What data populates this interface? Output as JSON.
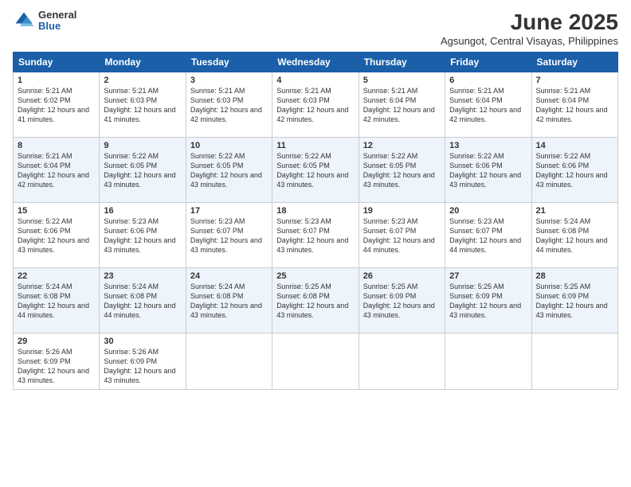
{
  "logo": {
    "general": "General",
    "blue": "Blue"
  },
  "header": {
    "month": "June 2025",
    "location": "Agsungot, Central Visayas, Philippines"
  },
  "weekdays": [
    "Sunday",
    "Monday",
    "Tuesday",
    "Wednesday",
    "Thursday",
    "Friday",
    "Saturday"
  ],
  "weeks": [
    [
      {
        "day": "1",
        "sunrise": "5:21 AM",
        "sunset": "6:02 PM",
        "daylight": "12 hours and 41 minutes."
      },
      {
        "day": "2",
        "sunrise": "5:21 AM",
        "sunset": "6:03 PM",
        "daylight": "12 hours and 41 minutes."
      },
      {
        "day": "3",
        "sunrise": "5:21 AM",
        "sunset": "6:03 PM",
        "daylight": "12 hours and 42 minutes."
      },
      {
        "day": "4",
        "sunrise": "5:21 AM",
        "sunset": "6:03 PM",
        "daylight": "12 hours and 42 minutes."
      },
      {
        "day": "5",
        "sunrise": "5:21 AM",
        "sunset": "6:04 PM",
        "daylight": "12 hours and 42 minutes."
      },
      {
        "day": "6",
        "sunrise": "5:21 AM",
        "sunset": "6:04 PM",
        "daylight": "12 hours and 42 minutes."
      },
      {
        "day": "7",
        "sunrise": "5:21 AM",
        "sunset": "6:04 PM",
        "daylight": "12 hours and 42 minutes."
      }
    ],
    [
      {
        "day": "8",
        "sunrise": "5:21 AM",
        "sunset": "6:04 PM",
        "daylight": "12 hours and 42 minutes."
      },
      {
        "day": "9",
        "sunrise": "5:22 AM",
        "sunset": "6:05 PM",
        "daylight": "12 hours and 43 minutes."
      },
      {
        "day": "10",
        "sunrise": "5:22 AM",
        "sunset": "6:05 PM",
        "daylight": "12 hours and 43 minutes."
      },
      {
        "day": "11",
        "sunrise": "5:22 AM",
        "sunset": "6:05 PM",
        "daylight": "12 hours and 43 minutes."
      },
      {
        "day": "12",
        "sunrise": "5:22 AM",
        "sunset": "6:05 PM",
        "daylight": "12 hours and 43 minutes."
      },
      {
        "day": "13",
        "sunrise": "5:22 AM",
        "sunset": "6:06 PM",
        "daylight": "12 hours and 43 minutes."
      },
      {
        "day": "14",
        "sunrise": "5:22 AM",
        "sunset": "6:06 PM",
        "daylight": "12 hours and 43 minutes."
      }
    ],
    [
      {
        "day": "15",
        "sunrise": "5:22 AM",
        "sunset": "6:06 PM",
        "daylight": "12 hours and 43 minutes."
      },
      {
        "day": "16",
        "sunrise": "5:23 AM",
        "sunset": "6:06 PM",
        "daylight": "12 hours and 43 minutes."
      },
      {
        "day": "17",
        "sunrise": "5:23 AM",
        "sunset": "6:07 PM",
        "daylight": "12 hours and 43 minutes."
      },
      {
        "day": "18",
        "sunrise": "5:23 AM",
        "sunset": "6:07 PM",
        "daylight": "12 hours and 43 minutes."
      },
      {
        "day": "19",
        "sunrise": "5:23 AM",
        "sunset": "6:07 PM",
        "daylight": "12 hours and 44 minutes."
      },
      {
        "day": "20",
        "sunrise": "5:23 AM",
        "sunset": "6:07 PM",
        "daylight": "12 hours and 44 minutes."
      },
      {
        "day": "21",
        "sunrise": "5:24 AM",
        "sunset": "6:08 PM",
        "daylight": "12 hours and 44 minutes."
      }
    ],
    [
      {
        "day": "22",
        "sunrise": "5:24 AM",
        "sunset": "6:08 PM",
        "daylight": "12 hours and 44 minutes."
      },
      {
        "day": "23",
        "sunrise": "5:24 AM",
        "sunset": "6:08 PM",
        "daylight": "12 hours and 44 minutes."
      },
      {
        "day": "24",
        "sunrise": "5:24 AM",
        "sunset": "6:08 PM",
        "daylight": "12 hours and 43 minutes."
      },
      {
        "day": "25",
        "sunrise": "5:25 AM",
        "sunset": "6:08 PM",
        "daylight": "12 hours and 43 minutes."
      },
      {
        "day": "26",
        "sunrise": "5:25 AM",
        "sunset": "6:09 PM",
        "daylight": "12 hours and 43 minutes."
      },
      {
        "day": "27",
        "sunrise": "5:25 AM",
        "sunset": "6:09 PM",
        "daylight": "12 hours and 43 minutes."
      },
      {
        "day": "28",
        "sunrise": "5:25 AM",
        "sunset": "6:09 PM",
        "daylight": "12 hours and 43 minutes."
      }
    ],
    [
      {
        "day": "29",
        "sunrise": "5:26 AM",
        "sunset": "6:09 PM",
        "daylight": "12 hours and 43 minutes."
      },
      {
        "day": "30",
        "sunrise": "5:26 AM",
        "sunset": "6:09 PM",
        "daylight": "12 hours and 43 minutes."
      },
      null,
      null,
      null,
      null,
      null
    ]
  ]
}
